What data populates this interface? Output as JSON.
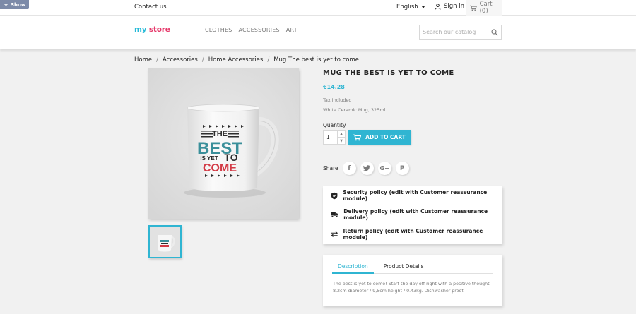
{
  "toolbar": {
    "show_label": "Show"
  },
  "topbar": {
    "contact": "Contact us",
    "language": "English",
    "signin": "Sign in",
    "cart": "Cart (0)"
  },
  "header": {
    "logo_my": "my",
    "logo_store": "store",
    "nav": [
      "CLOTHES",
      "ACCESSORIES",
      "ART"
    ],
    "search_placeholder": "Search our catalog"
  },
  "breadcrumb": [
    "Home",
    "Accessories",
    "Home Accessories",
    "Mug The best is yet to come"
  ],
  "product": {
    "title": "MUG THE BEST IS YET TO COME",
    "price": "€14.28",
    "tax": "Tax included",
    "short_description": "White Ceramic Mug, 325ml.",
    "quantity_label": "Quantity",
    "quantity_value": "1",
    "add_to_cart": "ADD TO CART",
    "share_label": "Share",
    "mug_text": {
      "the": "THE",
      "best": "BEST",
      "is_yet": "IS YET",
      "to": "TO",
      "come": "COME"
    }
  },
  "reassurance": [
    {
      "icon": "shield-icon",
      "label": "Security policy (edit with Customer reassurance module)"
    },
    {
      "icon": "truck-icon",
      "label": "Delivery policy (edit with Customer reassurance module)"
    },
    {
      "icon": "swap-arrows-icon",
      "label": "Return policy (edit with Customer reassurance module)"
    }
  ],
  "tabs": {
    "items": [
      "Description",
      "Product Details"
    ],
    "active": "Description",
    "description": "The best is yet to come! Start the day off right with a positive thought. 8,2cm diameter / 9,5cm height / 0.43kg. Dishwasher-proof."
  },
  "colors": {
    "accent": "#2fb5d2",
    "logo_pink": "#e6386a",
    "background": "#f1f1f1"
  }
}
